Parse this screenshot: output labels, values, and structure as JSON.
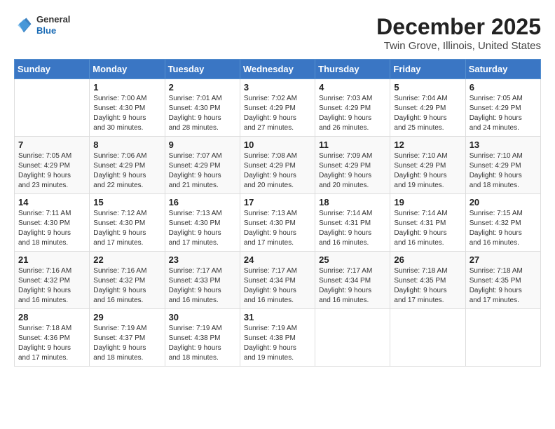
{
  "logo": {
    "general": "General",
    "blue": "Blue"
  },
  "title": "December 2025",
  "location": "Twin Grove, Illinois, United States",
  "days_of_week": [
    "Sunday",
    "Monday",
    "Tuesday",
    "Wednesday",
    "Thursday",
    "Friday",
    "Saturday"
  ],
  "weeks": [
    [
      {
        "day": "",
        "info": ""
      },
      {
        "day": "1",
        "info": "Sunrise: 7:00 AM\nSunset: 4:30 PM\nDaylight: 9 hours\nand 30 minutes."
      },
      {
        "day": "2",
        "info": "Sunrise: 7:01 AM\nSunset: 4:30 PM\nDaylight: 9 hours\nand 28 minutes."
      },
      {
        "day": "3",
        "info": "Sunrise: 7:02 AM\nSunset: 4:29 PM\nDaylight: 9 hours\nand 27 minutes."
      },
      {
        "day": "4",
        "info": "Sunrise: 7:03 AM\nSunset: 4:29 PM\nDaylight: 9 hours\nand 26 minutes."
      },
      {
        "day": "5",
        "info": "Sunrise: 7:04 AM\nSunset: 4:29 PM\nDaylight: 9 hours\nand 25 minutes."
      },
      {
        "day": "6",
        "info": "Sunrise: 7:05 AM\nSunset: 4:29 PM\nDaylight: 9 hours\nand 24 minutes."
      }
    ],
    [
      {
        "day": "7",
        "info": "Sunrise: 7:05 AM\nSunset: 4:29 PM\nDaylight: 9 hours\nand 23 minutes."
      },
      {
        "day": "8",
        "info": "Sunrise: 7:06 AM\nSunset: 4:29 PM\nDaylight: 9 hours\nand 22 minutes."
      },
      {
        "day": "9",
        "info": "Sunrise: 7:07 AM\nSunset: 4:29 PM\nDaylight: 9 hours\nand 21 minutes."
      },
      {
        "day": "10",
        "info": "Sunrise: 7:08 AM\nSunset: 4:29 PM\nDaylight: 9 hours\nand 20 minutes."
      },
      {
        "day": "11",
        "info": "Sunrise: 7:09 AM\nSunset: 4:29 PM\nDaylight: 9 hours\nand 20 minutes."
      },
      {
        "day": "12",
        "info": "Sunrise: 7:10 AM\nSunset: 4:29 PM\nDaylight: 9 hours\nand 19 minutes."
      },
      {
        "day": "13",
        "info": "Sunrise: 7:10 AM\nSunset: 4:29 PM\nDaylight: 9 hours\nand 18 minutes."
      }
    ],
    [
      {
        "day": "14",
        "info": "Sunrise: 7:11 AM\nSunset: 4:30 PM\nDaylight: 9 hours\nand 18 minutes."
      },
      {
        "day": "15",
        "info": "Sunrise: 7:12 AM\nSunset: 4:30 PM\nDaylight: 9 hours\nand 17 minutes."
      },
      {
        "day": "16",
        "info": "Sunrise: 7:13 AM\nSunset: 4:30 PM\nDaylight: 9 hours\nand 17 minutes."
      },
      {
        "day": "17",
        "info": "Sunrise: 7:13 AM\nSunset: 4:30 PM\nDaylight: 9 hours\nand 17 minutes."
      },
      {
        "day": "18",
        "info": "Sunrise: 7:14 AM\nSunset: 4:31 PM\nDaylight: 9 hours\nand 16 minutes."
      },
      {
        "day": "19",
        "info": "Sunrise: 7:14 AM\nSunset: 4:31 PM\nDaylight: 9 hours\nand 16 minutes."
      },
      {
        "day": "20",
        "info": "Sunrise: 7:15 AM\nSunset: 4:32 PM\nDaylight: 9 hours\nand 16 minutes."
      }
    ],
    [
      {
        "day": "21",
        "info": "Sunrise: 7:16 AM\nSunset: 4:32 PM\nDaylight: 9 hours\nand 16 minutes."
      },
      {
        "day": "22",
        "info": "Sunrise: 7:16 AM\nSunset: 4:32 PM\nDaylight: 9 hours\nand 16 minutes."
      },
      {
        "day": "23",
        "info": "Sunrise: 7:17 AM\nSunset: 4:33 PM\nDaylight: 9 hours\nand 16 minutes."
      },
      {
        "day": "24",
        "info": "Sunrise: 7:17 AM\nSunset: 4:34 PM\nDaylight: 9 hours\nand 16 minutes."
      },
      {
        "day": "25",
        "info": "Sunrise: 7:17 AM\nSunset: 4:34 PM\nDaylight: 9 hours\nand 16 minutes."
      },
      {
        "day": "26",
        "info": "Sunrise: 7:18 AM\nSunset: 4:35 PM\nDaylight: 9 hours\nand 17 minutes."
      },
      {
        "day": "27",
        "info": "Sunrise: 7:18 AM\nSunset: 4:35 PM\nDaylight: 9 hours\nand 17 minutes."
      }
    ],
    [
      {
        "day": "28",
        "info": "Sunrise: 7:18 AM\nSunset: 4:36 PM\nDaylight: 9 hours\nand 17 minutes."
      },
      {
        "day": "29",
        "info": "Sunrise: 7:19 AM\nSunset: 4:37 PM\nDaylight: 9 hours\nand 18 minutes."
      },
      {
        "day": "30",
        "info": "Sunrise: 7:19 AM\nSunset: 4:38 PM\nDaylight: 9 hours\nand 18 minutes."
      },
      {
        "day": "31",
        "info": "Sunrise: 7:19 AM\nSunset: 4:38 PM\nDaylight: 9 hours\nand 19 minutes."
      },
      {
        "day": "",
        "info": ""
      },
      {
        "day": "",
        "info": ""
      },
      {
        "day": "",
        "info": ""
      }
    ]
  ]
}
